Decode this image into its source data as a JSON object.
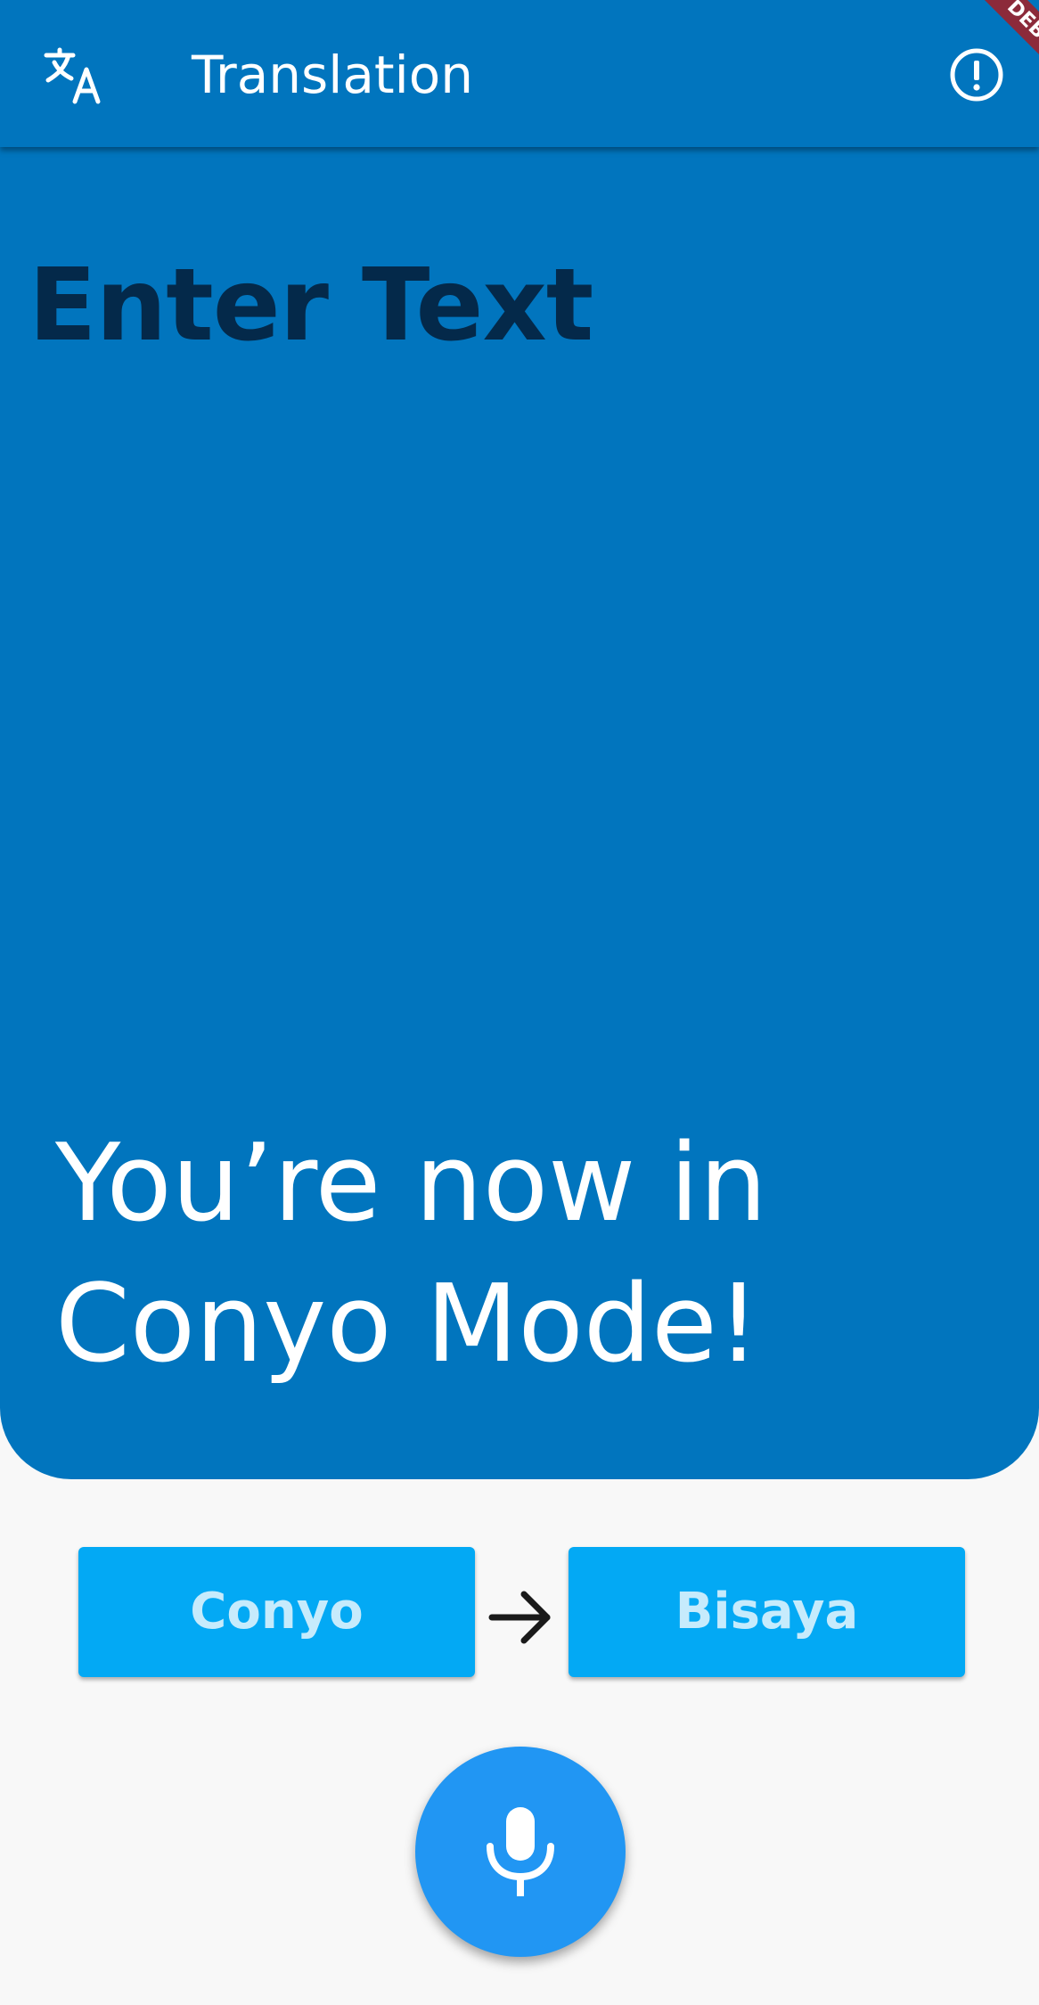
{
  "appbar": {
    "title": "Translation",
    "leading_icon": "translate-icon",
    "trailing_icon": "info-icon"
  },
  "debug_banner": {
    "label": "DEBUG"
  },
  "input": {
    "placeholder": "Enter Text",
    "overlay_message": "You’re now in Conyo Mode!"
  },
  "languages": {
    "from": "Conyo",
    "to": "Bisaya",
    "swap_icon": "arrow-right-icon"
  },
  "mic": {
    "icon": "microphone-icon"
  },
  "colors": {
    "primary": "#0175be",
    "button": "#03a9f4",
    "fab": "#2196f3",
    "background": "#f8f8f8",
    "debug": "#8c2a3a"
  }
}
